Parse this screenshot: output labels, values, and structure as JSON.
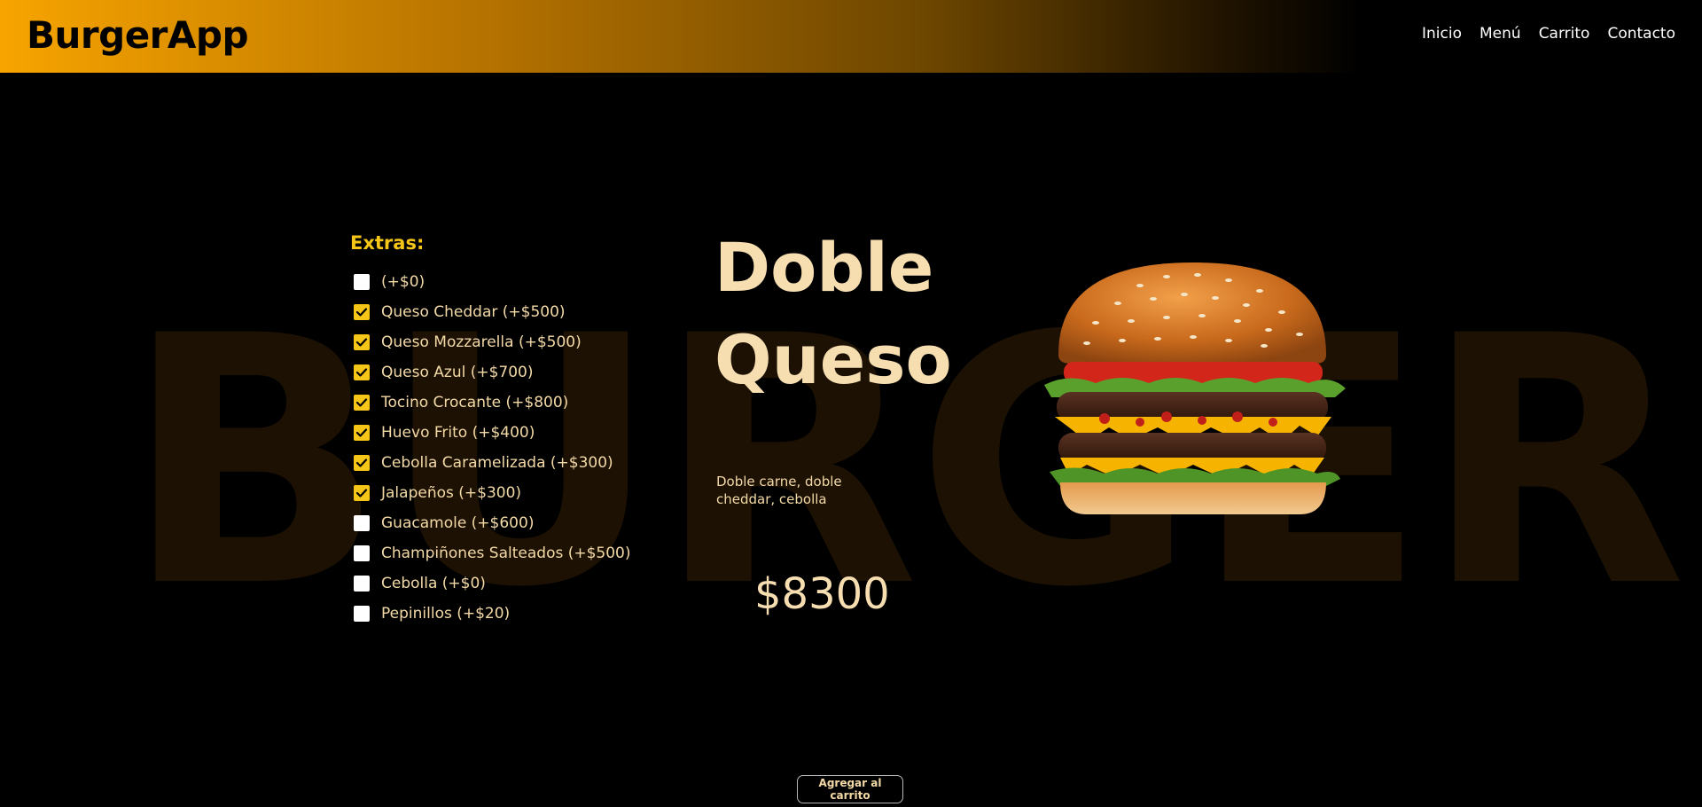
{
  "header": {
    "brand": "BurgerApp",
    "nav": [
      "Inicio",
      "Menú",
      "Carrito",
      "Contacto"
    ]
  },
  "background_word": "BURGER",
  "extras": {
    "title": "Extras:",
    "items": [
      {
        "label": "(+$0)",
        "checked": false
      },
      {
        "label": "Queso Cheddar (+$500)",
        "checked": true
      },
      {
        "label": "Queso Mozzarella (+$500)",
        "checked": true
      },
      {
        "label": "Queso Azul (+$700)",
        "checked": true
      },
      {
        "label": "Tocino Crocante (+$800)",
        "checked": true
      },
      {
        "label": "Huevo Frito (+$400)",
        "checked": true
      },
      {
        "label": "Cebolla Caramelizada (+$300)",
        "checked": true
      },
      {
        "label": "Jalapeños (+$300)",
        "checked": true
      },
      {
        "label": "Guacamole (+$600)",
        "checked": false
      },
      {
        "label": "Champiñones Salteados (+$500)",
        "checked": false
      },
      {
        "label": "Cebolla (+$0)",
        "checked": false
      },
      {
        "label": "Pepinillos (+$20)",
        "checked": false
      }
    ]
  },
  "product": {
    "title_line1": "Doble",
    "title_line2": "Queso",
    "description": "Doble carne, doble cheddar, cebolla",
    "price": "$8300",
    "image_icon": "burger-image"
  },
  "actions": {
    "add_to_cart": "Agregar al carrito"
  },
  "colors": {
    "accent": "#f5c518",
    "header_start": "#f7a400",
    "text_cream": "#f6deb0"
  }
}
